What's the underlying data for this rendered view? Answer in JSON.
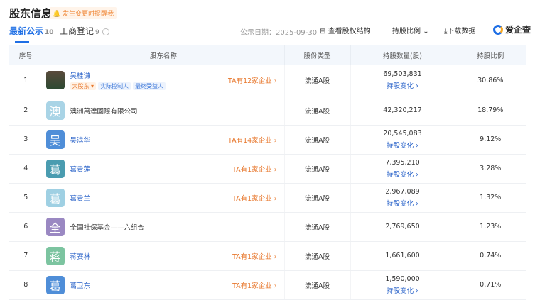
{
  "header": {
    "title": "股东信息",
    "remind": "发生变更时提醒我"
  },
  "tabs": [
    {
      "label": "最新公示",
      "count": "10"
    },
    {
      "label": "工商登记",
      "count": "9"
    }
  ],
  "toolbar": {
    "date_label": "公示日期：2025-09-30",
    "equity_structure": "查看股权结构",
    "ratio_select": "持股比例",
    "download": "下载数据",
    "logo": "爱企查"
  },
  "columns": [
    "序号",
    "股东名称",
    "股份类型",
    "持股数量(股)",
    "持股比例"
  ],
  "change_label": "持股变化 ›",
  "rows": [
    {
      "no": "1",
      "avatar": "",
      "color": "",
      "name": "吴桂谦",
      "link": true,
      "tags": [
        "大股东 ▾",
        "实际控制人",
        "最终受益人"
      ],
      "ta": "TA有12家企业 ›",
      "type": "流通A股",
      "qty": "69,503,831",
      "change": true,
      "ratio": "30.86%"
    },
    {
      "no": "2",
      "avatar": "澳",
      "color": "#a9d4e6",
      "name": "澳洲萬達國際有限公司",
      "link": false,
      "tags": [],
      "ta": "",
      "type": "流通A股",
      "qty": "42,320,217",
      "change": false,
      "ratio": "18.79%"
    },
    {
      "no": "3",
      "avatar": "吴",
      "color": "#4f8ed8",
      "name": "吴滨华",
      "link": true,
      "tags": [],
      "ta": "TA有14家企业 ›",
      "type": "流通A股",
      "qty": "20,545,083",
      "change": true,
      "ratio": "9.12%"
    },
    {
      "no": "4",
      "avatar": "葛",
      "color": "#4a9cb0",
      "name": "葛贵莲",
      "link": true,
      "tags": [],
      "ta": "TA有1家企业 ›",
      "type": "流通A股",
      "qty": "7,395,210",
      "change": true,
      "ratio": "3.28%"
    },
    {
      "no": "5",
      "avatar": "葛",
      "color": "#9fd0e3",
      "name": "葛贵兰",
      "link": true,
      "tags": [],
      "ta": "TA有1家企业 ›",
      "type": "流通A股",
      "qty": "2,967,089",
      "change": true,
      "ratio": "1.32%"
    },
    {
      "no": "6",
      "avatar": "全",
      "color": "#9a88c2",
      "name": "全国社保基金——六组合",
      "link": false,
      "tags": [],
      "ta": "",
      "type": "流通A股",
      "qty": "2,769,650",
      "change": false,
      "ratio": "1.23%"
    },
    {
      "no": "7",
      "avatar": "蒋",
      "color": "#7cc4a0",
      "name": "蒋赛林",
      "link": true,
      "tags": [],
      "ta": "TA有1家企业 ›",
      "type": "流通A股",
      "qty": "1,661,600",
      "change": false,
      "ratio": "0.74%"
    },
    {
      "no": "8",
      "avatar": "葛",
      "color": "#4f8ed8",
      "name": "葛卫东",
      "link": true,
      "tags": [],
      "ta": "TA有1家企业 ›",
      "type": "流通A股",
      "qty": "1,590,000",
      "change": true,
      "ratio": "0.71%"
    }
  ]
}
